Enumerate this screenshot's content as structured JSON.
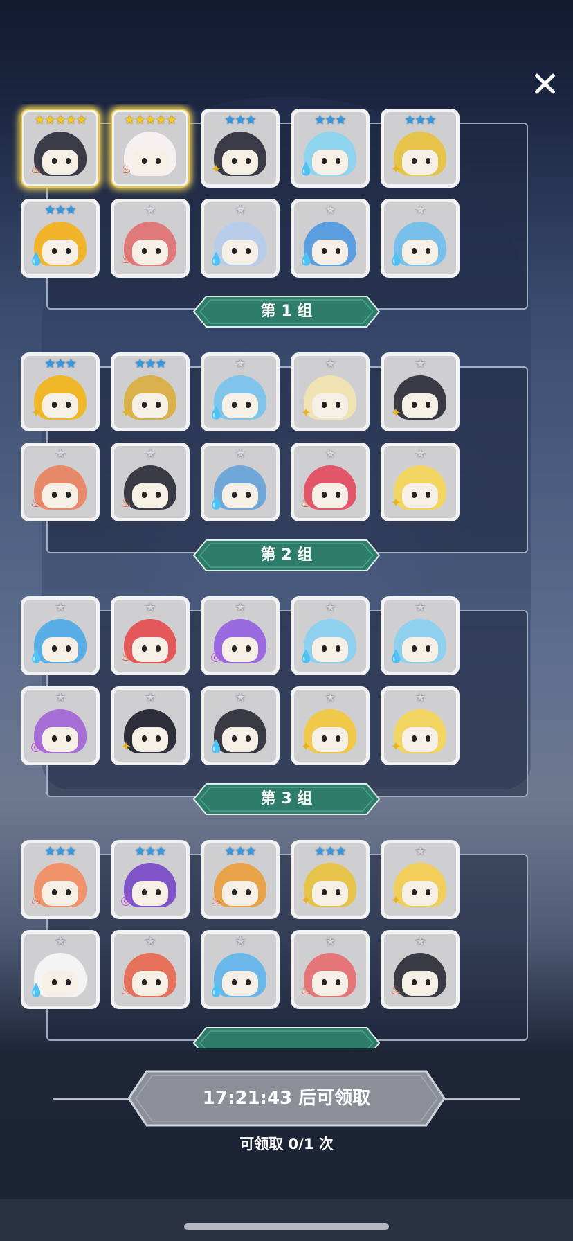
{
  "groups": [
    {
      "label": "第 1 组",
      "cards": [
        {
          "stars": "★★★★★",
          "rarity": "gold",
          "element": "fire",
          "color": "#3b3b48",
          "glow": true
        },
        {
          "stars": "★★★★★",
          "rarity": "gold",
          "element": "fire",
          "color": "#f7f0f0",
          "glow": true
        },
        {
          "stars": "★★★",
          "rarity": "blue",
          "element": "wind",
          "color": "#3b3b48",
          "glow": false
        },
        {
          "stars": "★★★",
          "rarity": "blue",
          "element": "water",
          "color": "#8fd3ef",
          "glow": false
        },
        {
          "stars": "★★★",
          "rarity": "blue",
          "element": "wind",
          "color": "#e6c44a",
          "glow": false
        },
        {
          "stars": "★★★",
          "rarity": "blue",
          "element": "water",
          "color": "#f1b42a",
          "glow": false
        },
        {
          "stars": "★",
          "rarity": "grey",
          "element": "fire",
          "color": "#e07a7a",
          "glow": false
        },
        {
          "stars": "★",
          "rarity": "grey",
          "element": "water",
          "color": "#b8cdea",
          "glow": false
        },
        {
          "stars": "★",
          "rarity": "grey",
          "element": "water",
          "color": "#5a9ee0",
          "glow": false
        },
        {
          "stars": "★",
          "rarity": "grey",
          "element": "water",
          "color": "#78c0ea",
          "glow": false
        }
      ]
    },
    {
      "label": "第 2 组",
      "cards": [
        {
          "stars": "★★★",
          "rarity": "blue",
          "element": "wind",
          "color": "#f0b828",
          "glow": false
        },
        {
          "stars": "★★★",
          "rarity": "blue",
          "element": "wind",
          "color": "#d9b04a",
          "glow": false
        },
        {
          "stars": "★",
          "rarity": "grey",
          "element": "water",
          "color": "#7fc4ea",
          "glow": false
        },
        {
          "stars": "★",
          "rarity": "grey",
          "element": "wind",
          "color": "#f1e2b4",
          "glow": false
        },
        {
          "stars": "★",
          "rarity": "grey",
          "element": "wind",
          "color": "#3a3a44",
          "glow": false
        },
        {
          "stars": "★",
          "rarity": "grey",
          "element": "fire",
          "color": "#e88a6a",
          "glow": false
        },
        {
          "stars": "★",
          "rarity": "grey",
          "element": "fire",
          "color": "#3a3a44",
          "glow": false
        },
        {
          "stars": "★",
          "rarity": "grey",
          "element": "water",
          "color": "#6fa8d8",
          "glow": false
        },
        {
          "stars": "★",
          "rarity": "grey",
          "element": "fire",
          "color": "#e2566a",
          "glow": false
        },
        {
          "stars": "★",
          "rarity": "grey",
          "element": "wind",
          "color": "#f2d460",
          "glow": false
        }
      ]
    },
    {
      "label": "第 3 组",
      "cards": [
        {
          "stars": "★",
          "rarity": "grey",
          "element": "water",
          "color": "#5aaee6",
          "glow": false
        },
        {
          "stars": "★",
          "rarity": "grey",
          "element": "fire",
          "color": "#e4585a",
          "glow": false
        },
        {
          "stars": "★",
          "rarity": "grey",
          "element": "void",
          "color": "#9a6ae0",
          "glow": false
        },
        {
          "stars": "★",
          "rarity": "grey",
          "element": "water",
          "color": "#8fd0ef",
          "glow": false
        },
        {
          "stars": "★",
          "rarity": "grey",
          "element": "water",
          "color": "#8fd0ef",
          "glow": false
        },
        {
          "stars": "★",
          "rarity": "grey",
          "element": "void",
          "color": "#a86ed8",
          "glow": false
        },
        {
          "stars": "★",
          "rarity": "grey",
          "element": "wind",
          "color": "#2e2e3a",
          "glow": false
        },
        {
          "stars": "★",
          "rarity": "grey",
          "element": "water",
          "color": "#3a3a44",
          "glow": false
        },
        {
          "stars": "★",
          "rarity": "grey",
          "element": "wind",
          "color": "#f0c84a",
          "glow": false
        },
        {
          "stars": "★",
          "rarity": "grey",
          "element": "wind",
          "color": "#f2d460",
          "glow": false
        }
      ]
    },
    {
      "label": "",
      "cards": [
        {
          "stars": "★★★",
          "rarity": "blue",
          "element": "fire",
          "color": "#f0926a",
          "glow": false
        },
        {
          "stars": "★★★",
          "rarity": "blue",
          "element": "void",
          "color": "#7e54c8",
          "glow": false
        },
        {
          "stars": "★★★",
          "rarity": "blue",
          "element": "fire",
          "color": "#e8a24a",
          "glow": false
        },
        {
          "stars": "★★★",
          "rarity": "blue",
          "element": "wind",
          "color": "#e6c44a",
          "glow": false
        },
        {
          "stars": "★",
          "rarity": "grey",
          "element": "wind",
          "color": "#f2cf5a",
          "glow": false
        },
        {
          "stars": "★",
          "rarity": "grey",
          "element": "water",
          "color": "#f4f4f4",
          "glow": false
        },
        {
          "stars": "★",
          "rarity": "grey",
          "element": "fire",
          "color": "#e6705a",
          "glow": false
        },
        {
          "stars": "★",
          "rarity": "grey",
          "element": "water",
          "color": "#6ab8ea",
          "glow": false
        },
        {
          "stars": "★",
          "rarity": "grey",
          "element": "fire",
          "color": "#e4767a",
          "glow": false
        },
        {
          "stars": "★",
          "rarity": "grey",
          "element": "fire",
          "color": "#3a3a44",
          "glow": false
        }
      ]
    }
  ],
  "element_icons": {
    "fire": "♨",
    "water": "💧",
    "wind": "✦",
    "void": "◎"
  },
  "claim": {
    "label": "17:21:43 后可领取"
  },
  "claim_count": "可领取 0/1 次",
  "colors": {
    "banner": "#2e7d6a",
    "claim_button": "#8a8f98"
  }
}
